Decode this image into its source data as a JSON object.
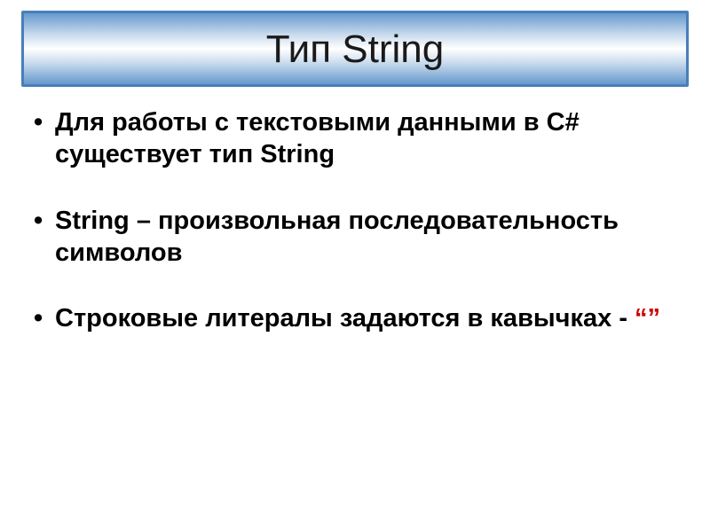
{
  "title": "Тип String",
  "bullets": [
    {
      "text": "Для работы с текстовыми данными в C# существует тип String",
      "has_quote": false
    },
    {
      "text": "String – произвольная последовательность символов",
      "has_quote": false
    },
    {
      "text": "Строковые литералы задаются в кавычках - ",
      "has_quote": true,
      "quote": "“”"
    }
  ]
}
